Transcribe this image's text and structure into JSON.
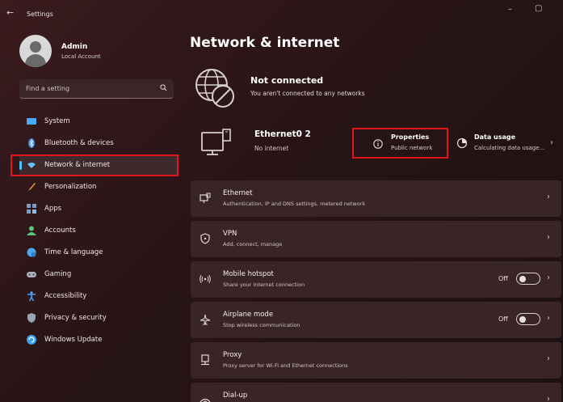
{
  "window": {
    "back_glyph": "←",
    "title": "Settings",
    "minimize_glyph": "–",
    "maximize_glyph": "▢"
  },
  "user": {
    "name": "Admin",
    "account_type": "Local Account"
  },
  "search": {
    "placeholder": "Find a setting",
    "icon": "search-icon"
  },
  "sidebar": {
    "items": [
      {
        "label": "System",
        "icon": "system-icon",
        "color": "#4aa8ff"
      },
      {
        "label": "Bluetooth & devices",
        "icon": "bluetooth-icon",
        "color": "#3b8fe0"
      },
      {
        "label": "Network & internet",
        "icon": "wifi-icon",
        "color": "#63c5ff",
        "selected": true
      },
      {
        "label": "Personalization",
        "icon": "brush-icon",
        "color": "#f0a040"
      },
      {
        "label": "Apps",
        "icon": "apps-icon",
        "color": "#7d9cc4"
      },
      {
        "label": "Accounts",
        "icon": "accounts-icon",
        "color": "#5cc37a"
      },
      {
        "label": "Time & language",
        "icon": "globe-clock-icon",
        "color": "#4aa8e8"
      },
      {
        "label": "Gaming",
        "icon": "gamepad-icon",
        "color": "#a9b2bd"
      },
      {
        "label": "Accessibility",
        "icon": "accessibility-icon",
        "color": "#47a6ff"
      },
      {
        "label": "Privacy & security",
        "icon": "shield-icon",
        "color": "#9aa6b4"
      },
      {
        "label": "Windows Update",
        "icon": "update-icon",
        "color": "#3ea0ea"
      }
    ]
  },
  "main": {
    "title": "Network & internet",
    "status": {
      "title": "Not connected",
      "subtitle": "You aren't connected to any networks",
      "icon": "globe-disconnected-icon"
    },
    "adapter": {
      "name": "Ethernet0 2",
      "state": "No internet",
      "icon": "ethernet-icon"
    },
    "properties": {
      "title": "Properties",
      "subtitle": "Public network",
      "icon": "info-icon"
    },
    "data_usage": {
      "title": "Data usage",
      "subtitle": "Calculating data usage...",
      "icon": "data-usage-icon",
      "chevron": "›"
    },
    "cards": [
      {
        "title": "Ethernet",
        "subtitle": "Authentication, IP and DNS settings, metered network",
        "icon": "ethernet-icon",
        "chevron": "›"
      },
      {
        "title": "VPN",
        "subtitle": "Add, connect, manage",
        "icon": "vpn-shield-icon",
        "chevron": "›"
      },
      {
        "title": "Mobile hotspot",
        "subtitle": "Share your internet connection",
        "icon": "hotspot-icon",
        "state": "Off",
        "toggle": false,
        "chevron": "›"
      },
      {
        "title": "Airplane mode",
        "subtitle": "Stop wireless communication",
        "icon": "airplane-icon",
        "state": "Off",
        "toggle": false,
        "chevron": "›"
      },
      {
        "title": "Proxy",
        "subtitle": "Proxy server for Wi-Fi and Ethernet connections",
        "icon": "proxy-icon",
        "chevron": "›"
      },
      {
        "title": "Dial-up",
        "subtitle": "",
        "icon": "dialup-icon",
        "chevron": "›"
      }
    ]
  },
  "colors": {
    "accent": "#4cc2ff",
    "highlight_box": "#e0161c",
    "card_bg": "#3a2526"
  }
}
